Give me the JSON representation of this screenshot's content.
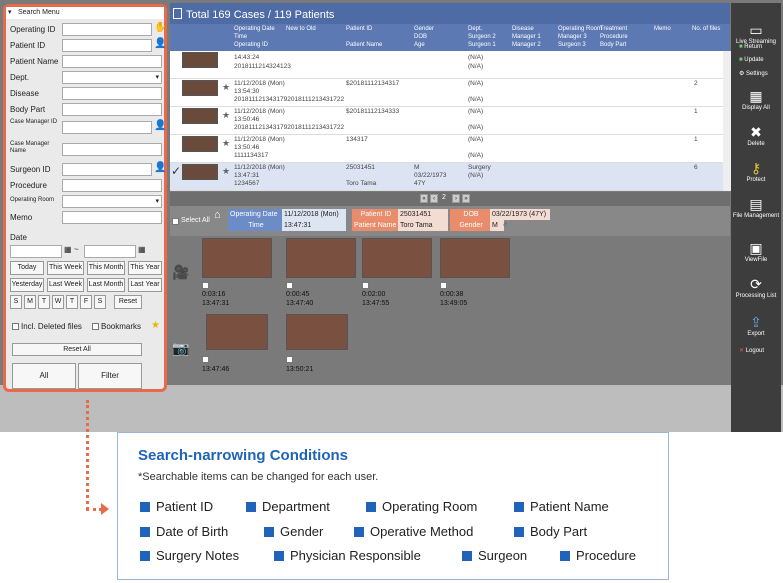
{
  "header": {
    "title": "Total 169 Cases / 119 Patients"
  },
  "columns": [
    "Operating Date",
    "New to Old",
    "Time",
    "Operating ID",
    "Patient ID",
    "Patient Name",
    "Gender",
    "DOB",
    "Age",
    "Dept.",
    "Surgeon 1",
    "Disease",
    "Manager 1",
    "Manager 2",
    "Surgeon 2",
    "Operating Room",
    "Manager 3",
    "Surgeon 3",
    "Treatment",
    "Procedure",
    "Body Part",
    "Memo",
    "No. of files"
  ],
  "rows": [
    {
      "date": "",
      "time": "14:43:24",
      "opid": "2018111214324123",
      "pid": "",
      "name": "",
      "gender": "",
      "dob": "",
      "age": "",
      "dept": "(N/A)",
      "surgeon": "(N/A)",
      "files": ""
    },
    {
      "date": "11/12/2018 (Mon)",
      "time": "13:54:30",
      "opid": "2018111213431792018111213431722",
      "pid": "$20181112134317",
      "name": "",
      "gender": "",
      "dob": "",
      "age": "",
      "dept": "(N/A)",
      "surgeon": "(N/A)",
      "files": "2"
    },
    {
      "date": "11/12/2018 (Mon)",
      "time": "13:50:46",
      "opid": "2018111213431792018111213431722",
      "pid": "$20181112134333",
      "name": "",
      "gender": "",
      "dob": "",
      "age": "",
      "dept": "(N/A)",
      "surgeon": "(N/A)",
      "files": "1"
    },
    {
      "date": "11/12/2018 (Mon)",
      "time": "13:50:46",
      "opid": "1111134317",
      "pid": "134317",
      "name": "",
      "gender": "",
      "dob": "",
      "age": "",
      "dept": "(N/A)",
      "surgeon": "(N/A)",
      "files": "1"
    },
    {
      "date": "11/12/2018 (Mon)",
      "time": "13:47:31",
      "opid": "1234567",
      "pid": "25031451",
      "name": "Toro Tama",
      "gender": "M",
      "dob": "03/22/1973",
      "age": "47Y",
      "dept": "Surgery",
      "surgeon": "(N/A)",
      "files": "6"
    }
  ],
  "pager": {
    "page": "2"
  },
  "detail": {
    "select_all": "Select All",
    "op_date_label": "Operating Date",
    "op_date": "11/12/2018 (Mon)",
    "time_label": "Time",
    "time": "13:47:31",
    "pid_label": "Patient ID",
    "pid": "25031451",
    "pname_label": "Patient Name",
    "pname": "Toro Tama",
    "dob_label": "DOB",
    "dob": "03/22/1973 (47Y)",
    "gender_label": "Gender",
    "gender": "M"
  },
  "videos": [
    {
      "dur": "0:03:16",
      "ts": "13:47:31"
    },
    {
      "dur": "0:00:45",
      "ts": "13:47:40"
    },
    {
      "dur": "0:02:00",
      "ts": "13:47:55"
    },
    {
      "dur": "0:00:38",
      "ts": "13:49:05"
    }
  ],
  "photos": [
    {
      "ts": "13:47:46"
    },
    {
      "ts": "13:50:21"
    }
  ],
  "rightbar": {
    "live": "Live Streaming",
    "return": "Return",
    "update": "Update",
    "settings": "Settings",
    "display_all": "Display All",
    "delete": "Delete",
    "protect": "Protect",
    "file_mgmt": "File Management",
    "viewfile": "ViewFile",
    "processing": "Processing List",
    "export": "Export",
    "logout": "Logout"
  },
  "search": {
    "title": "Search Menu",
    "operating_id": "Operating ID",
    "patient_id": "Patient ID",
    "patient_name": "Patient Name",
    "dept": "Dept.",
    "disease": "Disease",
    "body_part": "Body Part",
    "case_mgr_id": "Case Manager ID",
    "case_mgr_name": "Case Manager Name",
    "surgeon_id": "Surgeon ID",
    "procedure": "Procedure",
    "operating_room": "Operating Room",
    "memo": "Memo",
    "date": "Date",
    "today": "Today",
    "this_week": "This Week",
    "this_month": "This Month",
    "this_year": "This Year",
    "yesterday": "Yesterday",
    "last_week": "Last Week",
    "last_month": "Last Month",
    "last_year": "Last Year",
    "days": [
      "S",
      "M",
      "T",
      "W",
      "T",
      "F",
      "S"
    ],
    "reset": "Reset",
    "incl_deleted": "Incl. Deleted files",
    "bookmarks": "Bookmarks",
    "reset_all": "Reset All",
    "all": "All",
    "filter": "Filter"
  },
  "callout": {
    "title": "Search-narrowing Conditions",
    "note": "*Searchable items can be changed for each user.",
    "items": [
      "Patient ID",
      "Department",
      "Operating Room",
      "Patient Name",
      "Date of Birth",
      "Gender",
      "Operative Method",
      "Body Part",
      "Surgery Notes",
      "Physician Responsible",
      "Surgeon",
      "Procedure"
    ]
  },
  "colors": {
    "accent": "#1f64b8",
    "highlight": "#e96a4a",
    "header": "#4e6ba6"
  }
}
